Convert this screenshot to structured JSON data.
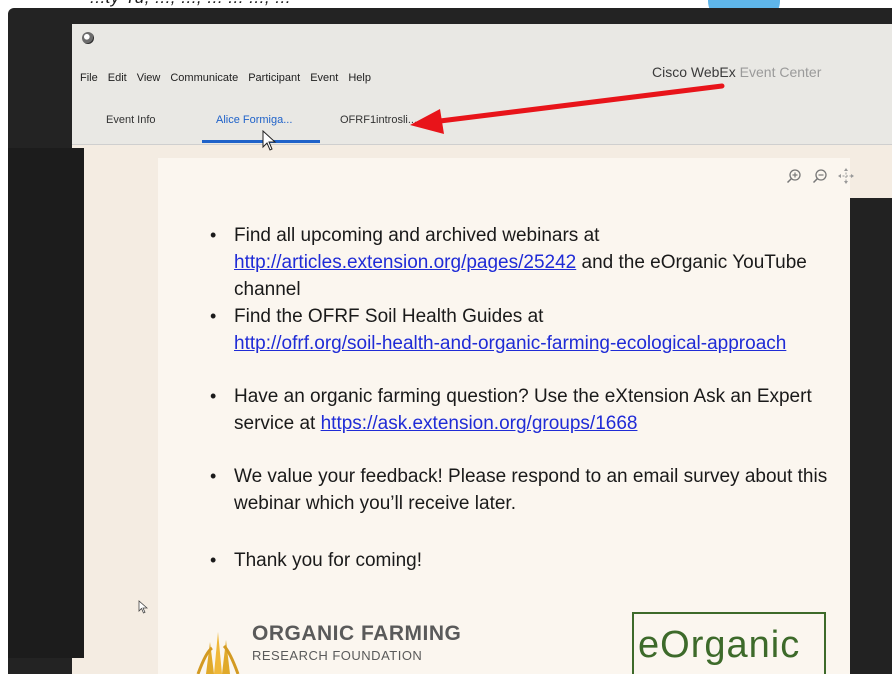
{
  "caption": {
    "text": "...ty Tu, ..., ..., ... ... ..., ..."
  },
  "app": {
    "title_main": "Cisco WebEx",
    "title_faded": "Event Center"
  },
  "menu": [
    "File",
    "Edit",
    "View",
    "Communicate",
    "Participant",
    "Event",
    "Help"
  ],
  "tabs": [
    {
      "label": "Event Info",
      "active": false
    },
    {
      "label": "Alice Formiga...",
      "active": true
    },
    {
      "label": "OFRF1introsli...",
      "active": false
    }
  ],
  "toolbar": {
    "icons": [
      "zoom-in-icon",
      "zoom-out-icon",
      "move-icon"
    ]
  },
  "slide": {
    "bullets": [
      {
        "text_before": "Find all upcoming and archived webinars at",
        "link": "http://articles.extension.org/pages/25242",
        "text_after": " and the eOrganic YouTube channel"
      },
      {
        "text_before": "Find the OFRF Soil Health Guides at",
        "link": "http://ofrf.org/soil-health-and-organic-farming-ecological-approach",
        "text_after": ""
      },
      {
        "text_before": "Have an organic farming question? Use the eXtension Ask an Expert service at ",
        "link": "https://ask.extension.org/groups/1668",
        "text_after": ""
      },
      {
        "text_before": "We value your feedback! Please respond to an email survey about this webinar which you’ll receive later.",
        "link": "",
        "text_after": ""
      },
      {
        "text_before": "Thank you for coming!",
        "link": "",
        "text_after": ""
      }
    ],
    "logo_left": {
      "name": "ORGANIC FARMING",
      "sub": "RESEARCH FOUNDATION"
    },
    "logo_right": {
      "name": "eOrganic"
    }
  },
  "colors": {
    "accent": "#1f62c9",
    "link": "#1f2bd6",
    "arrow": "#e8141a",
    "logo_green": "#3d6a2a"
  }
}
